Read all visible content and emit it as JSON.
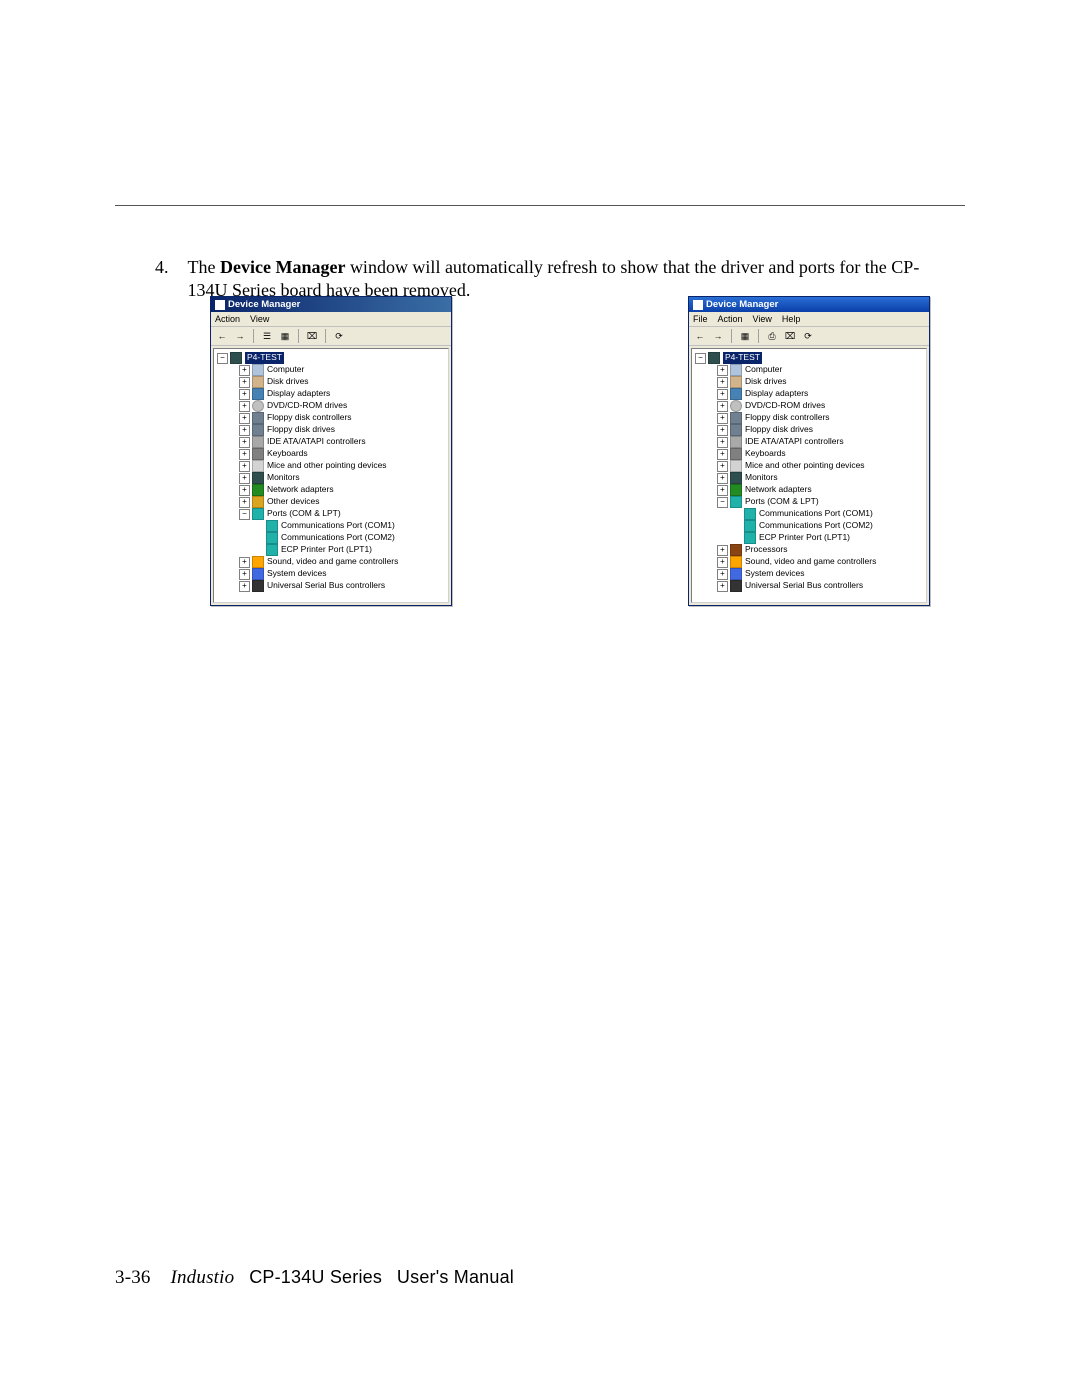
{
  "step": {
    "number": "4.",
    "text_prefix": "The ",
    "bold": "Device Manager",
    "text_suffix": " window will automatically refresh to show that the driver and ports for the CP-134U Series board have been removed."
  },
  "left": {
    "title": "Device Manager",
    "menus": [
      "Action",
      "View"
    ],
    "root": "P4-TEST",
    "nodes": [
      {
        "exp": "+",
        "icon": "ic-computer",
        "label": "Computer",
        "indent": 2
      },
      {
        "exp": "+",
        "icon": "ic-disk",
        "label": "Disk drives",
        "indent": 2
      },
      {
        "exp": "+",
        "icon": "ic-display",
        "label": "Display adapters",
        "indent": 2
      },
      {
        "exp": "+",
        "icon": "ic-cd",
        "label": "DVD/CD-ROM drives",
        "indent": 2
      },
      {
        "exp": "+",
        "icon": "ic-floppy",
        "label": "Floppy disk controllers",
        "indent": 2
      },
      {
        "exp": "+",
        "icon": "ic-floppy",
        "label": "Floppy disk drives",
        "indent": 2
      },
      {
        "exp": "+",
        "icon": "ic-ide",
        "label": "IDE ATA/ATAPI controllers",
        "indent": 2
      },
      {
        "exp": "+",
        "icon": "ic-keyboard",
        "label": "Keyboards",
        "indent": 2
      },
      {
        "exp": "+",
        "icon": "ic-mouse",
        "label": "Mice and other pointing devices",
        "indent": 2
      },
      {
        "exp": "+",
        "icon": "ic-monitor",
        "label": "Monitors",
        "indent": 2
      },
      {
        "exp": "+",
        "icon": "ic-net",
        "label": "Network adapters",
        "indent": 2
      },
      {
        "exp": "+",
        "icon": "ic-other",
        "label": "Other devices",
        "indent": 2
      },
      {
        "exp": "−",
        "icon": "ic-ports",
        "label": "Ports (COM & LPT)",
        "indent": 2
      },
      {
        "exp": "",
        "icon": "ic-port",
        "label": "Communications Port (COM1)",
        "indent": 3
      },
      {
        "exp": "",
        "icon": "ic-port",
        "label": "Communications Port (COM2)",
        "indent": 3
      },
      {
        "exp": "",
        "icon": "ic-port",
        "label": "ECP Printer Port (LPT1)",
        "indent": 3
      },
      {
        "exp": "+",
        "icon": "ic-sound",
        "label": "Sound, video and game controllers",
        "indent": 2
      },
      {
        "exp": "+",
        "icon": "ic-system",
        "label": "System devices",
        "indent": 2
      },
      {
        "exp": "+",
        "icon": "ic-usb",
        "label": "Universal Serial Bus controllers",
        "indent": 2
      }
    ]
  },
  "right": {
    "title": "Device Manager",
    "menus": [
      "File",
      "Action",
      "View",
      "Help"
    ],
    "root": "P4-TEST",
    "nodes": [
      {
        "exp": "+",
        "icon": "ic-computer",
        "label": "Computer",
        "indent": 2
      },
      {
        "exp": "+",
        "icon": "ic-disk",
        "label": "Disk drives",
        "indent": 2
      },
      {
        "exp": "+",
        "icon": "ic-display",
        "label": "Display adapters",
        "indent": 2
      },
      {
        "exp": "+",
        "icon": "ic-cd",
        "label": "DVD/CD-ROM drives",
        "indent": 2
      },
      {
        "exp": "+",
        "icon": "ic-floppy",
        "label": "Floppy disk controllers",
        "indent": 2
      },
      {
        "exp": "+",
        "icon": "ic-floppy",
        "label": "Floppy disk drives",
        "indent": 2
      },
      {
        "exp": "+",
        "icon": "ic-ide",
        "label": "IDE ATA/ATAPI controllers",
        "indent": 2
      },
      {
        "exp": "+",
        "icon": "ic-keyboard",
        "label": "Keyboards",
        "indent": 2
      },
      {
        "exp": "+",
        "icon": "ic-mouse",
        "label": "Mice and other pointing devices",
        "indent": 2
      },
      {
        "exp": "+",
        "icon": "ic-monitor",
        "label": "Monitors",
        "indent": 2
      },
      {
        "exp": "+",
        "icon": "ic-net",
        "label": "Network adapters",
        "indent": 2
      },
      {
        "exp": "−",
        "icon": "ic-ports",
        "label": "Ports (COM & LPT)",
        "indent": 2
      },
      {
        "exp": "",
        "icon": "ic-port",
        "label": "Communications Port (COM1)",
        "indent": 3
      },
      {
        "exp": "",
        "icon": "ic-port",
        "label": "Communications Port (COM2)",
        "indent": 3
      },
      {
        "exp": "",
        "icon": "ic-port",
        "label": "ECP Printer Port (LPT1)",
        "indent": 3
      },
      {
        "exp": "+",
        "icon": "ic-proc",
        "label": "Processors",
        "indent": 2
      },
      {
        "exp": "+",
        "icon": "ic-sound",
        "label": "Sound, video and game controllers",
        "indent": 2
      },
      {
        "exp": "+",
        "icon": "ic-system",
        "label": "System devices",
        "indent": 2
      },
      {
        "exp": "+",
        "icon": "ic-usb",
        "label": "Universal Serial Bus controllers",
        "indent": 2
      }
    ]
  },
  "footer": {
    "page": "3-36",
    "brand": "Industio",
    "series": "CP-134U Series",
    "tail": "User's Manual"
  }
}
